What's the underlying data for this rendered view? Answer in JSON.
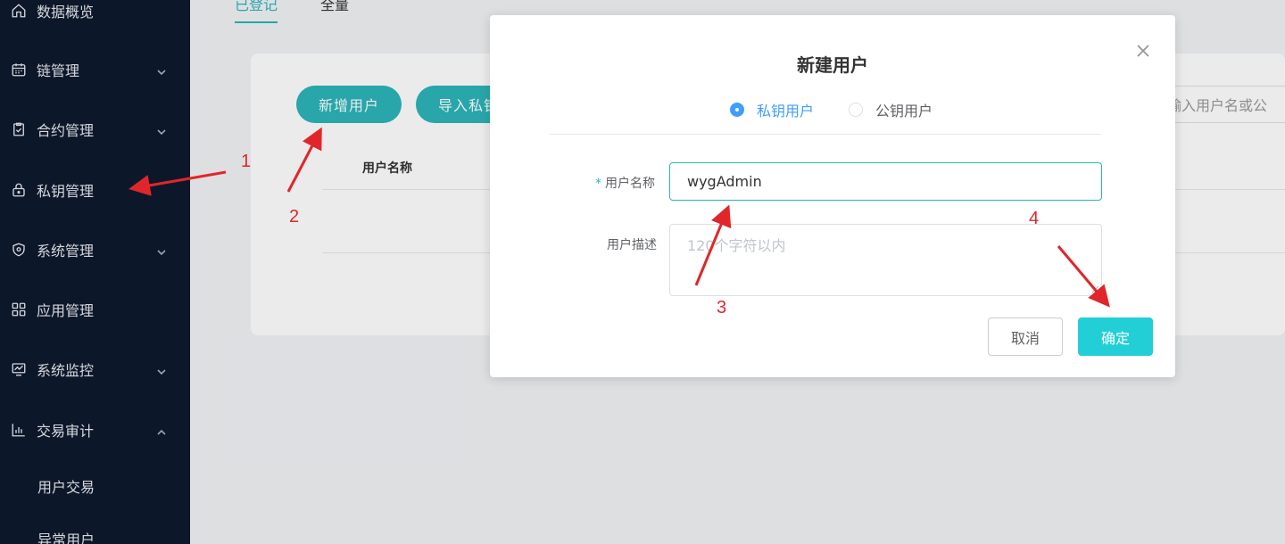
{
  "sidebar": {
    "items": [
      {
        "label": "数据概览",
        "icon": "home-icon"
      },
      {
        "label": "链管理",
        "icon": "calendar-icon",
        "has_chevron": true
      },
      {
        "label": "合约管理",
        "icon": "clipboard-check-icon",
        "has_chevron": true
      },
      {
        "label": "私钥管理",
        "icon": "lock-icon"
      },
      {
        "label": "系统管理",
        "icon": "shield-icon",
        "has_chevron": true
      },
      {
        "label": "应用管理",
        "icon": "grid-icon"
      },
      {
        "label": "系统监控",
        "icon": "monitor-chart-icon",
        "has_chevron": true
      },
      {
        "label": "交易审计",
        "icon": "bar-chart-icon",
        "has_chevron": true,
        "expanded": true
      }
    ],
    "sub_items": [
      {
        "label": "用户交易"
      },
      {
        "label": "异常用户"
      }
    ]
  },
  "main": {
    "tabs": [
      {
        "label": "已登记",
        "active": true
      },
      {
        "label": "全量",
        "active": false
      }
    ],
    "buttons": {
      "add_user": "新增用户",
      "import_key": "导入私钥"
    },
    "table_header": {
      "username": "用户名称"
    },
    "search_placeholder": "输入用户名或公"
  },
  "dialog": {
    "title": "新建用户",
    "radio_options": [
      {
        "label": "私钥用户",
        "checked": true
      },
      {
        "label": "公钥用户",
        "checked": false
      }
    ],
    "username_label": "用户名称",
    "required_mark": "*",
    "username_value": "wygAdmin",
    "description_label": "用户描述",
    "description_placeholder": "120个字符以内",
    "cancel_label": "取消",
    "confirm_label": "确定"
  },
  "annotations": {
    "labels": [
      "1",
      "2",
      "3",
      "4"
    ],
    "color": "#e0262a"
  },
  "colors": {
    "accent": "#2cb5b9",
    "primary_button": "#23cfd6",
    "radio_active": "#409eff",
    "sidebar_bg": "#0f1a2e"
  }
}
